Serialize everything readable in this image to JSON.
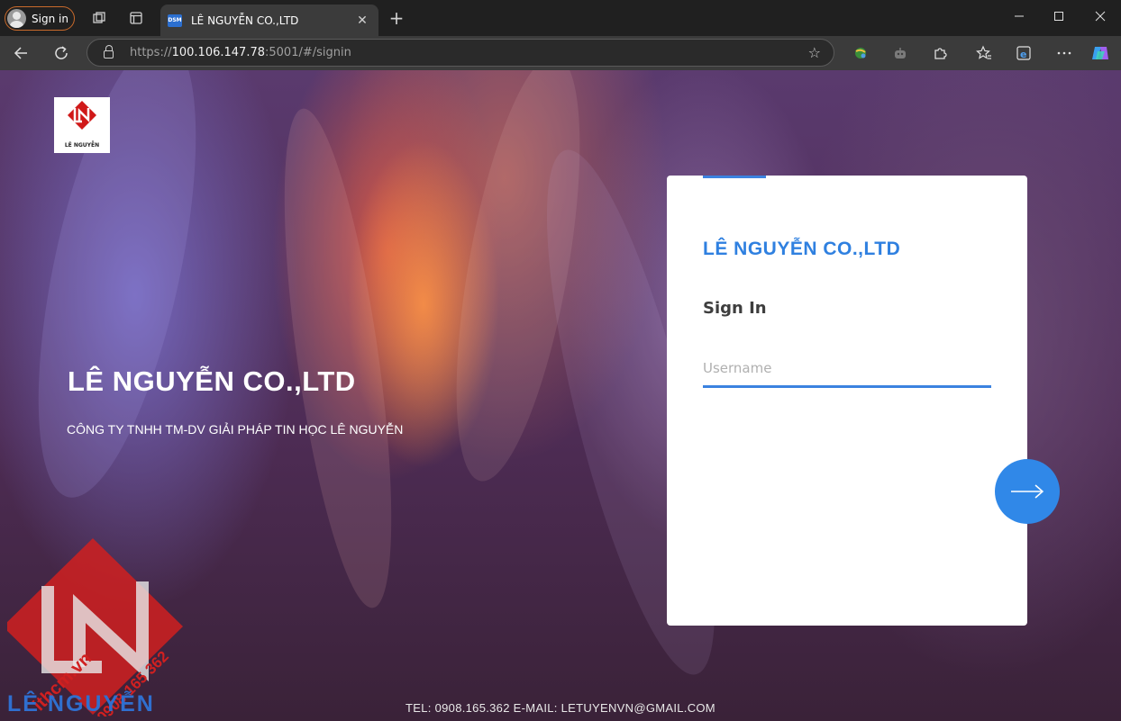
{
  "browser": {
    "profile_label": "Sign in",
    "tab_title": "LÊ NGUYỄN CO.,LTD",
    "favicon_text": "DSM",
    "url_scheme": "https://",
    "url_host": "100.106.147.78",
    "url_rest": ":5001/#/signin"
  },
  "page": {
    "logo_caption": "LÊ NGUYỄN",
    "hero_title": "LÊ NGUYỄN CO.,LTD",
    "hero_subtitle": "CÔNG TY TNHH TM-DV GIẢI PHÁP TIN HỌC LÊ NGUYỄN",
    "footer": "TEL: 0908.165.362 E-MAIL: LETUYENVN@GMAIL.COM"
  },
  "login": {
    "company": "LÊ NGUYỄN CO.,LTD",
    "heading": "Sign In",
    "username_placeholder": "Username",
    "username_value": "",
    "accent_color": "#3b82e0"
  },
  "watermark": {
    "site": "ithcm.vn",
    "phone": "0908 165 362",
    "brand": "LÊ NGUYỄN"
  }
}
